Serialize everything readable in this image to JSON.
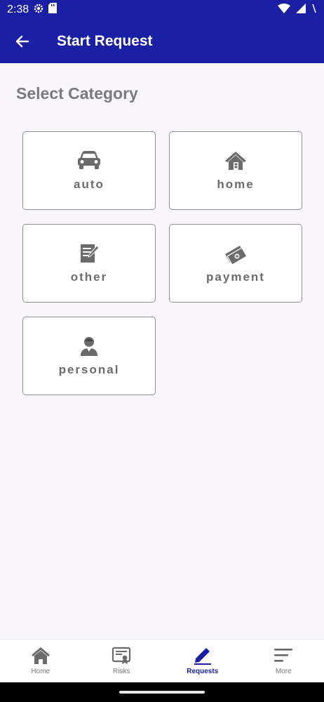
{
  "status_bar": {
    "time": "2:38"
  },
  "app_bar": {
    "title": "Start Request"
  },
  "main": {
    "section_title": "Select Category",
    "categories": [
      {
        "label": "auto",
        "icon": "car-icon"
      },
      {
        "label": "home",
        "icon": "house-icon"
      },
      {
        "label": "other",
        "icon": "note-icon"
      },
      {
        "label": "payment",
        "icon": "money-icon"
      },
      {
        "label": "personal",
        "icon": "person-icon"
      }
    ]
  },
  "bottom_nav": {
    "items": [
      {
        "label": "Home",
        "icon": "home-icon"
      },
      {
        "label": "Risks",
        "icon": "certificate-icon"
      },
      {
        "label": "Requests",
        "icon": "pen-icon",
        "active": true
      },
      {
        "label": "More",
        "icon": "menu-icon"
      }
    ]
  },
  "colors": {
    "primary": "#1a1fa3",
    "icon_grey": "#6b6b6b",
    "background": "#f8f6fb"
  }
}
